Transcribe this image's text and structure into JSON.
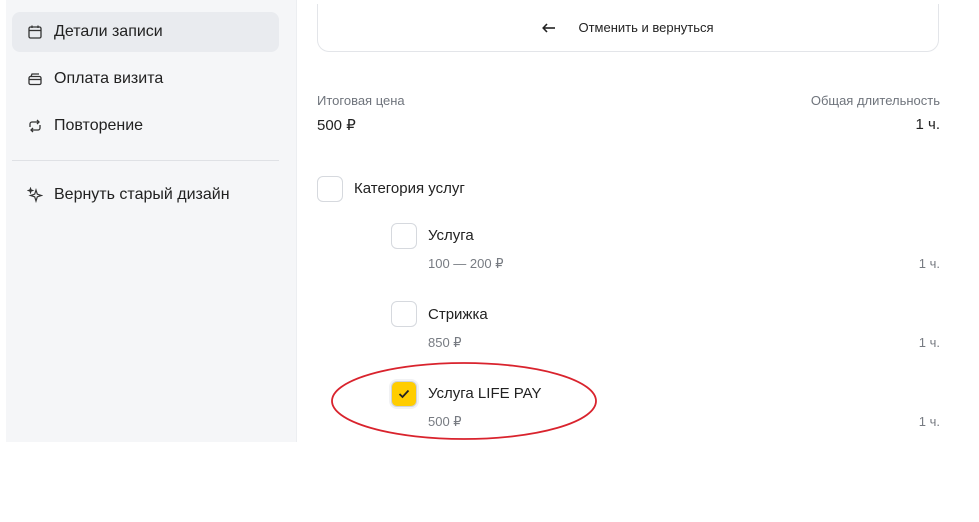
{
  "sidebar": {
    "items": [
      {
        "label": "Детали записи",
        "icon": "calendar-icon",
        "active": true
      },
      {
        "label": "Оплата визита",
        "icon": "payment-icon",
        "active": false
      },
      {
        "label": "Повторение",
        "icon": "repeat-icon",
        "active": false
      }
    ],
    "old_design": {
      "label": "Вернуть старый дизайн",
      "icon": "sparkle-icon"
    }
  },
  "main": {
    "cancel_label": "Отменить и вернуться",
    "total_price_label": "Итоговая цена",
    "total_price_value": "500 ₽",
    "total_duration_label": "Общая длительность",
    "total_duration_value": "1 ч.",
    "category": {
      "label": "Категория услуг",
      "checked": false
    },
    "services": [
      {
        "title": "Услуга",
        "price": "100 — 200 ₽",
        "duration": "1 ч.",
        "checked": false
      },
      {
        "title": "Стрижка",
        "price": "850 ₽",
        "duration": "1 ч.",
        "checked": false
      },
      {
        "title": "Услуга LIFE PAY",
        "price": "500 ₽",
        "duration": "1 ч.",
        "checked": true
      }
    ]
  },
  "colors": {
    "accent": "#ffcd00",
    "annotation": "#d9232d",
    "active_nav": "#e9ebef"
  }
}
